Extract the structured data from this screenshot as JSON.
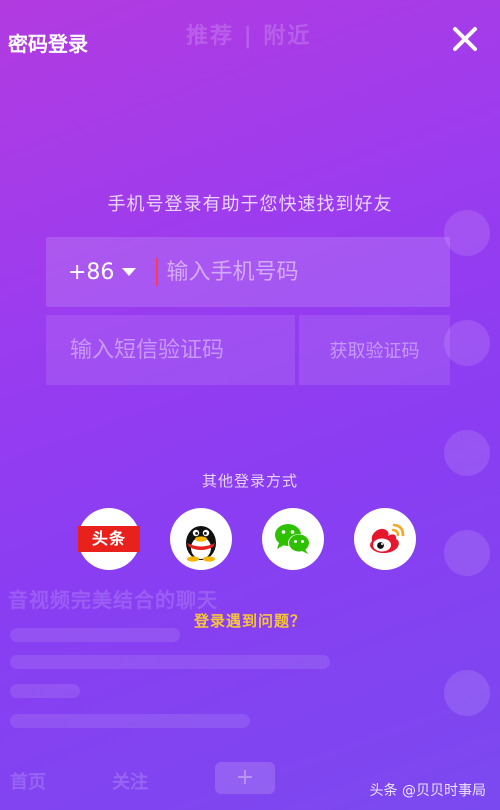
{
  "header": {
    "title": "密码登录"
  },
  "background": {
    "tabs": "推荐 | 附近",
    "video_title": "音视频完美结合的聊天",
    "bottom_nav": [
      "首页",
      "关注",
      "+"
    ]
  },
  "form": {
    "hint": "手机号登录有助于您快速找到好友",
    "country_code": "+86",
    "phone_placeholder": "输入手机号码",
    "code_placeholder": "输入短信验证码",
    "get_code_label": "获取验证码"
  },
  "other_login": {
    "label": "其他登录方式",
    "providers": [
      {
        "name": "头条",
        "icon": "toutiao-icon"
      },
      {
        "name": "QQ",
        "icon": "qq-icon"
      },
      {
        "name": "微信",
        "icon": "wechat-icon"
      },
      {
        "name": "微博",
        "icon": "weibo-icon"
      }
    ]
  },
  "trouble_link": "登录遇到问题？",
  "watermark": "头条 @贝贝时事局",
  "colors": {
    "accent_yellow": "#f6c43a",
    "toutiao_red": "#e8211d",
    "wechat_green": "#2dc100",
    "weibo_red": "#e6162d"
  }
}
